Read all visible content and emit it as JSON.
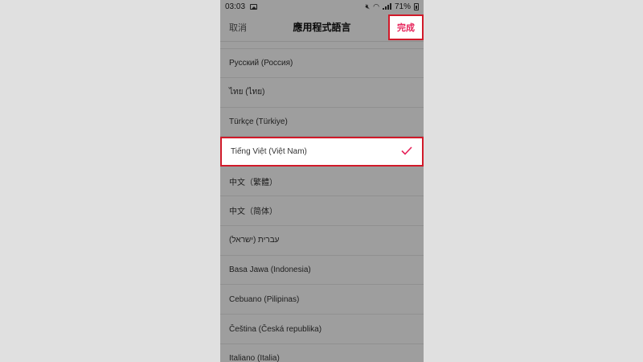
{
  "status_bar": {
    "time": "03:03",
    "battery": "71%"
  },
  "header": {
    "cancel_label": "取消",
    "title": "應用程式語言",
    "done_label": "完成"
  },
  "languages": [
    {
      "label": "Русский (Россия)"
    },
    {
      "label": "ไทย (ไทย)"
    },
    {
      "label": "Türkçe (Türkiye)"
    },
    {
      "label": "Tiếng Việt (Việt Nam)",
      "selected": true
    },
    {
      "label": "中文（繁體）"
    },
    {
      "label": "中文（简体）"
    },
    {
      "label": "עברית (ישראל)"
    },
    {
      "label": "Basa Jawa (Indonesia)"
    },
    {
      "label": "Cebuano (Pilipinas)"
    },
    {
      "label": "Čeština (Česká republika)"
    },
    {
      "label": "Italiano (Italia)"
    }
  ],
  "colors": {
    "accent": "#e6235a",
    "highlight_border": "#d11a2a",
    "background": "#e0e0e0"
  }
}
